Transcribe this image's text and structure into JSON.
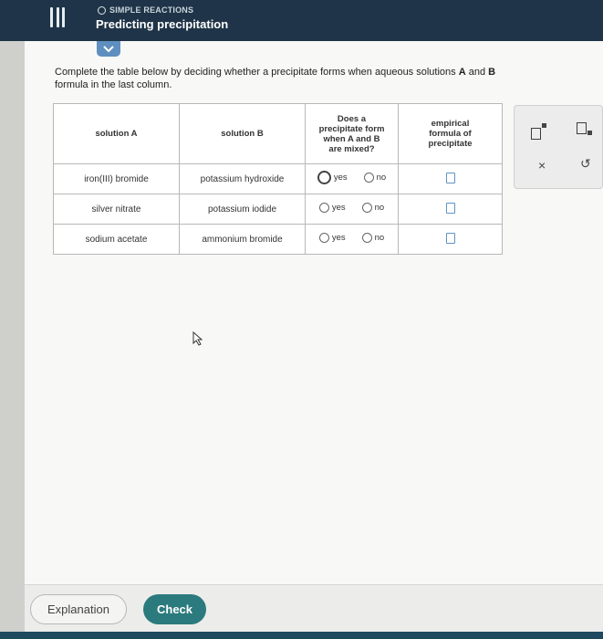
{
  "header": {
    "topic": "SIMPLE REACTIONS",
    "title": "Predicting precipitation"
  },
  "instructions": {
    "line1_start": "Complete the table below by deciding whether a precipitate forms when aqueous solutions ",
    "a": "A",
    "and": " and ",
    "b": "B",
    "line2": "formula in the last column."
  },
  "table": {
    "headers": {
      "solution_a": "solution A",
      "solution_b": "solution B",
      "precip_q": [
        "Does a",
        "precipitate form",
        "when A and B",
        "are mixed?"
      ],
      "formula": [
        "empirical",
        "formula of",
        "precipitate"
      ]
    },
    "rows": [
      {
        "a": "iron(III) bromide",
        "b": "potassium hydroxide",
        "yes": "yes",
        "no": "no"
      },
      {
        "a": "silver nitrate",
        "b": "potassium iodide",
        "yes": "yes",
        "no": "no"
      },
      {
        "a": "sodium acetate",
        "b": "ammonium bromide",
        "yes": "yes",
        "no": "no"
      }
    ]
  },
  "toolbar": {
    "clear": "×",
    "undo": "↺"
  },
  "footer": {
    "explanation": "Explanation",
    "check": "Check"
  }
}
